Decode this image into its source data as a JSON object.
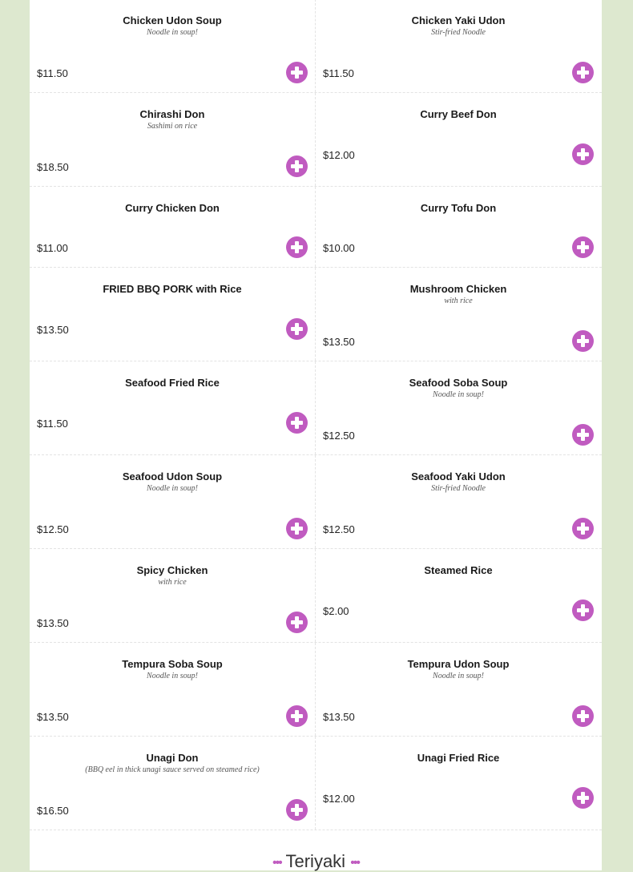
{
  "accent": "#c05bc0",
  "add_icon": "plus-circle-icon",
  "menu": [
    [
      {
        "name": "Chicken Udon Soup",
        "desc": "Noodle in soup!",
        "price": "$11.50"
      },
      {
        "name": "Chicken Yaki Udon",
        "desc": "Stir-fried Noodle",
        "price": "$11.50"
      }
    ],
    [
      {
        "name": "Chirashi Don",
        "desc": "Sashimi on rice",
        "price": "$18.50"
      },
      {
        "name": "Curry Beef Don",
        "desc": "",
        "price": "$12.00"
      }
    ],
    [
      {
        "name": "Curry Chicken Don",
        "desc": "",
        "price": "$11.00"
      },
      {
        "name": "Curry Tofu Don",
        "desc": "",
        "price": "$10.00"
      }
    ],
    [
      {
        "name": "FRIED BBQ PORK with Rice",
        "desc": "",
        "price": "$13.50"
      },
      {
        "name": "Mushroom Chicken",
        "desc": "with rice",
        "price": "$13.50"
      }
    ],
    [
      {
        "name": "Seafood Fried Rice",
        "desc": "",
        "price": "$11.50"
      },
      {
        "name": "Seafood Soba Soup",
        "desc": "Noodle in soup!",
        "price": "$12.50"
      }
    ],
    [
      {
        "name": "Seafood Udon Soup",
        "desc": "Noodle in soup!",
        "price": "$12.50"
      },
      {
        "name": "Seafood Yaki Udon",
        "desc": "Stir-fried Noodle",
        "price": "$12.50"
      }
    ],
    [
      {
        "name": "Spicy Chicken",
        "desc": "with rice",
        "price": "$13.50"
      },
      {
        "name": "Steamed Rice",
        "desc": "",
        "price": "$2.00"
      }
    ],
    [
      {
        "name": "Tempura Soba Soup",
        "desc": "Noodle in soup!",
        "price": "$13.50"
      },
      {
        "name": "Tempura Udon Soup",
        "desc": "Noodle in soup!",
        "price": "$13.50"
      }
    ],
    [
      {
        "name": "Unagi Don",
        "desc": "(BBQ eel in thick unagi sauce served on steamed rice)",
        "price": "$16.50"
      },
      {
        "name": "Unagi Fried Rice",
        "desc": "",
        "price": "$12.00"
      }
    ]
  ],
  "next_section": {
    "dots_left": "•••",
    "title": "Teriyaki",
    "dots_right": "•••"
  }
}
